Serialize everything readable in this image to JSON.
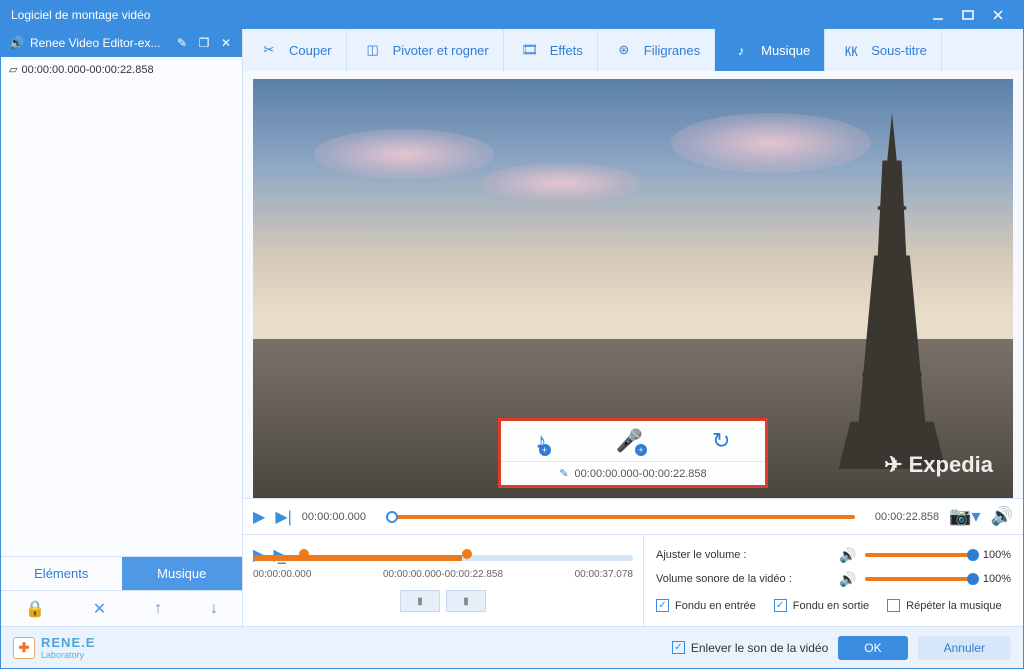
{
  "window": {
    "title": "Logiciel de montage vidéo"
  },
  "sidebar": {
    "file_name": "Renee Video Editor-ex...",
    "clip_range": "00:00:00.000-00:00:22.858",
    "tabs": {
      "elements": "Eléments",
      "music": "Musique"
    }
  },
  "toolbar": {
    "cut": "Couper",
    "rotate": "Pivoter et rogner",
    "effects": "Effets",
    "watermark": "Filigranes",
    "music": "Musique",
    "subtitle": "Sous-titre"
  },
  "preview": {
    "watermark": "Expedia",
    "callout_range": "00:00:00.000-00:00:22.858"
  },
  "transport": {
    "start": "00:00:00.000",
    "end": "00:00:22.858"
  },
  "timeline": {
    "t0": "00:00:00.000",
    "t1": "00:00:00.000-00:00:22.858",
    "t2": "00:00:37.078"
  },
  "volume": {
    "adjust_label": "Ajuster le volume :",
    "video_label": "Volume sonore de la vidéo :",
    "adjust_pct": "100%",
    "video_pct": "100%"
  },
  "checks": {
    "fade_in": "Fondu en entrée",
    "fade_out": "Fondu en sortie",
    "repeat": "Répéter la musique"
  },
  "footer": {
    "brand1": "RENE.E",
    "brand2": "Laboratory",
    "remove_sound": "Enlever le son de la vidéo",
    "ok": "OK",
    "cancel": "Annuler"
  }
}
